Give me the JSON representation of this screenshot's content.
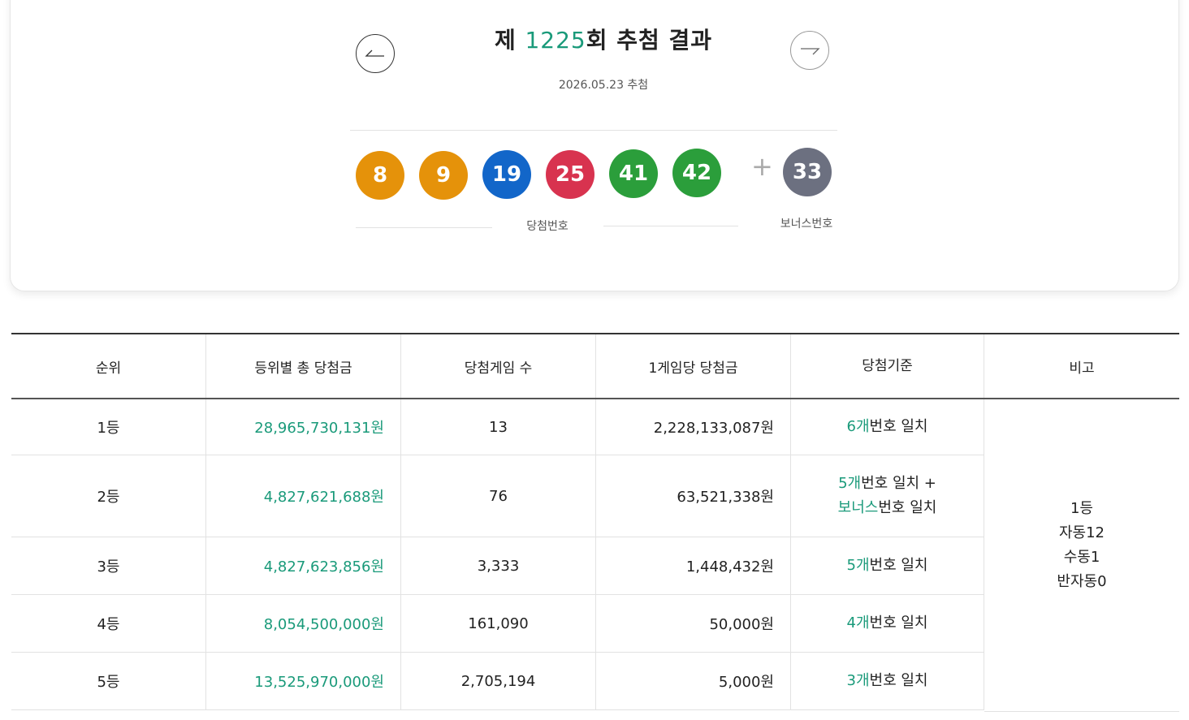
{
  "draw": {
    "title_prefix": "제 ",
    "round": "1225",
    "title_suffix": "회 추첨 결과",
    "date": "2026.05.23 추첨"
  },
  "numbers": {
    "winning": [
      "8",
      "9",
      "19",
      "25",
      "41",
      "42"
    ],
    "bonus": "33",
    "winning_label": "당첨번호",
    "bonus_label": "보너스번호",
    "plus": "+"
  },
  "colors": {
    "yellow": "#e5920a",
    "blue": "#1266c9",
    "red": "#d8334f",
    "green": "#2b9e3b",
    "gray": "#6c7080",
    "accent": "#1a9a7a"
  },
  "icons": {
    "prev": "arrow-left-icon",
    "next": "arrow-right-icon"
  },
  "table": {
    "headers": [
      "순위",
      "등위별 총 당첨금",
      "당첨게임 수",
      "1게임당 당첨금",
      "당첨기준",
      "비고"
    ],
    "rows": [
      {
        "rank": "1등",
        "total": "28,965,730,131원",
        "games": "13",
        "per_game": "2,228,133,087원",
        "criteria_num": "6개",
        "criteria_text": "번호 일치"
      },
      {
        "rank": "2등",
        "total": "4,827,621,688원",
        "games": "76",
        "per_game": "63,521,338원",
        "criteria_num": "5개",
        "criteria_text": "번호 일치 +",
        "criteria_num2": "보너스",
        "criteria_text2": "번호 일치"
      },
      {
        "rank": "3등",
        "total": "4,827,623,856원",
        "games": "3,333",
        "per_game": "1,448,432원",
        "criteria_num": "5개",
        "criteria_text": "번호 일치"
      },
      {
        "rank": "4등",
        "total": "8,054,500,000원",
        "games": "161,090",
        "per_game": "50,000원",
        "criteria_num": "4개",
        "criteria_text": "번호 일치"
      },
      {
        "rank": "5등",
        "total": "13,525,970,000원",
        "games": "2,705,194",
        "per_game": "5,000원",
        "criteria_num": "3개",
        "criteria_text": "번호 일치"
      }
    ],
    "note": [
      "1등",
      "자동12",
      "수동1",
      "반자동0"
    ]
  }
}
